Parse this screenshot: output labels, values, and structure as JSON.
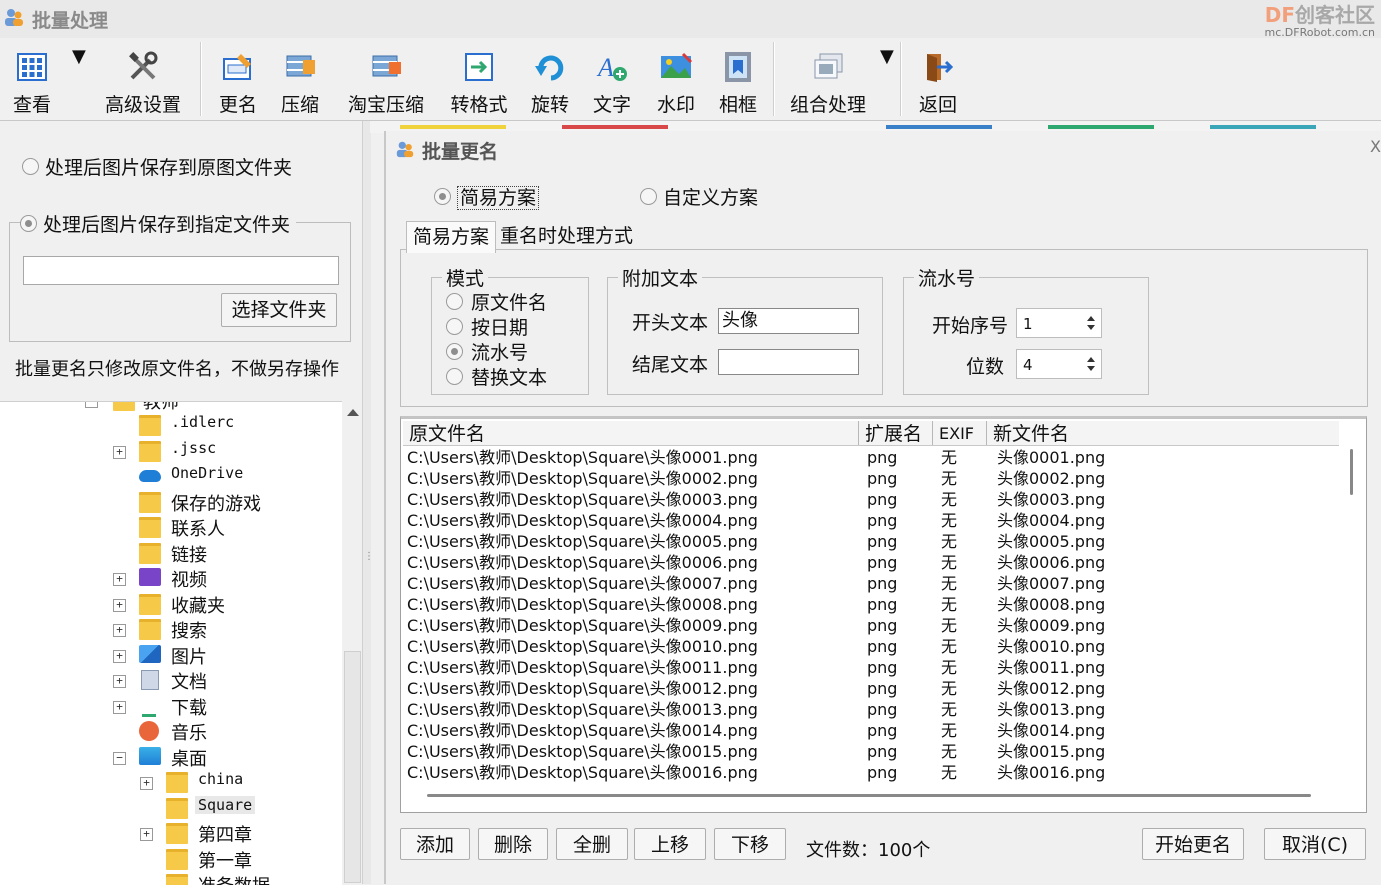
{
  "window": {
    "title": "批量处理"
  },
  "brand": {
    "logo_df": "DF",
    "logo_text": "创客社区",
    "url": "mc.DFRobot.com.cn"
  },
  "toolbar": {
    "view": "查看",
    "advanced": "高级设置",
    "rename": "更名",
    "compress": "压缩",
    "taobao_compress": "淘宝压缩",
    "convert": "转格式",
    "rotate": "旋转",
    "text": "文字",
    "watermark": "水印",
    "frame": "相框",
    "combo": "组合处理",
    "back": "返回"
  },
  "left_panel": {
    "save_original": "处理后图片保存到原图文件夹",
    "save_dest": "处理后图片保存到指定文件夹",
    "dest_path": "",
    "choose_folder": "选择文件夹",
    "note": "批量更名只修改原文件名，不做另存操作",
    "tree_partial": "教师",
    "tree": [
      {
        "label": ".idlerc",
        "icon": "folder-icon",
        "mono": true
      },
      {
        "label": ".jssc",
        "icon": "folder-icon",
        "mono": true,
        "expand": "+"
      },
      {
        "label": "OneDrive",
        "icon": "onedrive-icon",
        "mono": true
      },
      {
        "label": "保存的游戏",
        "icon": "folder-icon"
      },
      {
        "label": "联系人",
        "icon": "folder-icon"
      },
      {
        "label": "链接",
        "icon": "folder-icon"
      },
      {
        "label": "视频",
        "icon": "video-icon",
        "expand": "+"
      },
      {
        "label": "收藏夹",
        "icon": "folder-icon",
        "expand": "+"
      },
      {
        "label": "搜索",
        "icon": "folder-icon",
        "expand": "+"
      },
      {
        "label": "图片",
        "icon": "pictures-icon",
        "expand": "+"
      },
      {
        "label": "文档",
        "icon": "documents-icon",
        "expand": "+"
      },
      {
        "label": "下载",
        "icon": "download-icon",
        "expand": "+"
      },
      {
        "label": "音乐",
        "icon": "music-icon"
      },
      {
        "label": "桌面",
        "icon": "desktop-icon",
        "expand": "−"
      },
      {
        "label": "china",
        "icon": "folder-icon",
        "mono": true,
        "expand": "+",
        "indent": 1
      },
      {
        "label": "Square",
        "icon": "folder-icon",
        "mono": true,
        "indent": 1,
        "selected": true
      },
      {
        "label": "第四章",
        "icon": "folder-icon",
        "expand": "+",
        "indent": 1
      },
      {
        "label": "第一章",
        "icon": "folder-icon",
        "indent": 1
      },
      {
        "label": "准备数据",
        "icon": "folder-icon",
        "indent": 1
      }
    ]
  },
  "dialog": {
    "title": "批量更名",
    "close": "X",
    "scheme_simple": "简易方案",
    "scheme_custom": "自定义方案",
    "tab_simple": "简易方案",
    "tab_rename": "重名时处理方式",
    "mode_group": "模式",
    "mode_original": "原文件名",
    "mode_date": "按日期",
    "mode_serial": "流水号",
    "mode_replace": "替换文本",
    "append_group": "附加文本",
    "prefix_label": "开头文本",
    "prefix_value": "头像",
    "suffix_label": "结尾文本",
    "suffix_value": "",
    "serial_group": "流水号",
    "start_label": "开始序号",
    "start_value": "1",
    "digits_label": "位数",
    "digits_value": "4",
    "columns": [
      "原文件名",
      "扩展名",
      "EXIF",
      "新文件名"
    ],
    "rows": [
      [
        "C:\\Users\\教师\\Desktop\\Square\\头像0001.png",
        "png",
        "无",
        "头像0001.png"
      ],
      [
        "C:\\Users\\教师\\Desktop\\Square\\头像0002.png",
        "png",
        "无",
        "头像0002.png"
      ],
      [
        "C:\\Users\\教师\\Desktop\\Square\\头像0003.png",
        "png",
        "无",
        "头像0003.png"
      ],
      [
        "C:\\Users\\教师\\Desktop\\Square\\头像0004.png",
        "png",
        "无",
        "头像0004.png"
      ],
      [
        "C:\\Users\\教师\\Desktop\\Square\\头像0005.png",
        "png",
        "无",
        "头像0005.png"
      ],
      [
        "C:\\Users\\教师\\Desktop\\Square\\头像0006.png",
        "png",
        "无",
        "头像0006.png"
      ],
      [
        "C:\\Users\\教师\\Desktop\\Square\\头像0007.png",
        "png",
        "无",
        "头像0007.png"
      ],
      [
        "C:\\Users\\教师\\Desktop\\Square\\头像0008.png",
        "png",
        "无",
        "头像0008.png"
      ],
      [
        "C:\\Users\\教师\\Desktop\\Square\\头像0009.png",
        "png",
        "无",
        "头像0009.png"
      ],
      [
        "C:\\Users\\教师\\Desktop\\Square\\头像0010.png",
        "png",
        "无",
        "头像0010.png"
      ],
      [
        "C:\\Users\\教师\\Desktop\\Square\\头像0011.png",
        "png",
        "无",
        "头像0011.png"
      ],
      [
        "C:\\Users\\教师\\Desktop\\Square\\头像0012.png",
        "png",
        "无",
        "头像0012.png"
      ],
      [
        "C:\\Users\\教师\\Desktop\\Square\\头像0013.png",
        "png",
        "无",
        "头像0013.png"
      ],
      [
        "C:\\Users\\教师\\Desktop\\Square\\头像0014.png",
        "png",
        "无",
        "头像0014.png"
      ],
      [
        "C:\\Users\\教师\\Desktop\\Square\\头像0015.png",
        "png",
        "无",
        "头像0015.png"
      ],
      [
        "C:\\Users\\教师\\Desktop\\Square\\头像0016.png",
        "png",
        "无",
        "头像0016.png"
      ]
    ],
    "btn_add": "添加",
    "btn_delete": "删除",
    "btn_delete_all": "全删",
    "btn_up": "上移",
    "btn_down": "下移",
    "file_count": "文件数：100个",
    "btn_start": "开始更名",
    "btn_cancel": "取消(C)"
  },
  "colors": {
    "strip": [
      "#f0d23c",
      "#d94848",
      "#3a80c8",
      "#2fa86f",
      "#3aa6b8"
    ]
  }
}
